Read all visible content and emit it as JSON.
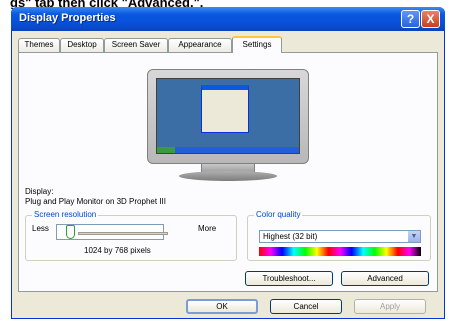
{
  "caption": {
    "prefix": "gs\" tab then click \"",
    "bold": "Advanced.",
    "suffix": "\"."
  },
  "window": {
    "title": "Display Properties"
  },
  "titlebar_buttons": {
    "help": "?",
    "close": "X"
  },
  "tabs": [
    {
      "label": "Themes"
    },
    {
      "label": "Desktop"
    },
    {
      "label": "Screen Saver"
    },
    {
      "label": "Appearance"
    },
    {
      "label": "Settings"
    }
  ],
  "display": {
    "label": "Display:",
    "value": "Plug and Play Monitor on 3D Prophet III"
  },
  "resolution": {
    "title": "Screen resolution",
    "less": "Less",
    "more": "More",
    "value": "1024 by 768 pixels"
  },
  "color_quality": {
    "title": "Color quality",
    "selected": "Highest (32 bit)"
  },
  "buttons": {
    "troubleshoot": "Troubleshoot...",
    "advanced": "Advanced",
    "ok": "OK",
    "cancel": "Cancel",
    "apply": "Apply"
  }
}
